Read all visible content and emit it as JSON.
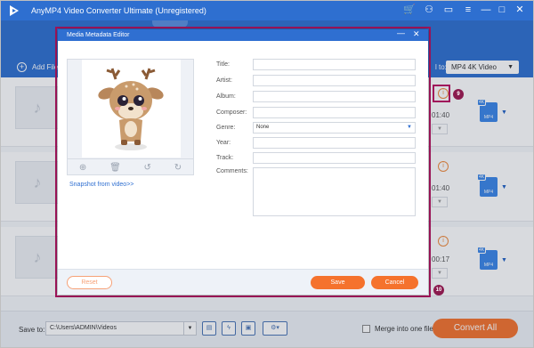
{
  "app": {
    "title": "AnyMP4 Video Converter Ultimate (Unregistered)"
  },
  "toolbar": {
    "add_files_label": "Add File",
    "convert_all_to_label": "l to:",
    "format_value": "MP4 4K Video"
  },
  "rows": [
    {
      "duration": "01:40",
      "format_badge": "4K",
      "format_name": "MP4"
    },
    {
      "duration": "01:40",
      "format_badge": "4K",
      "format_name": "MP4"
    },
    {
      "duration": "00:17",
      "format_badge": "4K",
      "format_name": "MP4"
    }
  ],
  "markers": {
    "info_marker": "9",
    "dialog_marker": "10"
  },
  "dialog": {
    "title": "Media Metadata Editor",
    "snapshot_link": "Snapshot from video>>",
    "fields": {
      "title_label": "Title:",
      "artist_label": "Artist:",
      "album_label": "Album:",
      "composer_label": "Composer:",
      "genre_label": "Genre:",
      "genre_value": "None",
      "year_label": "Year:",
      "track_label": "Track:",
      "comments_label": "Comments:"
    },
    "buttons": {
      "reset": "Reset",
      "save": "Save",
      "cancel": "Cancel"
    }
  },
  "bottom": {
    "save_to_label": "Save to:",
    "save_to_path": "C:\\Users\\ADMIN\\Videos",
    "merge_label": "Merge into one file",
    "convert_all_label": "Convert All"
  },
  "colors": {
    "primary_blue": "#2e6fd0",
    "accent_orange": "#f5722d",
    "highlight": "#a0145a"
  }
}
